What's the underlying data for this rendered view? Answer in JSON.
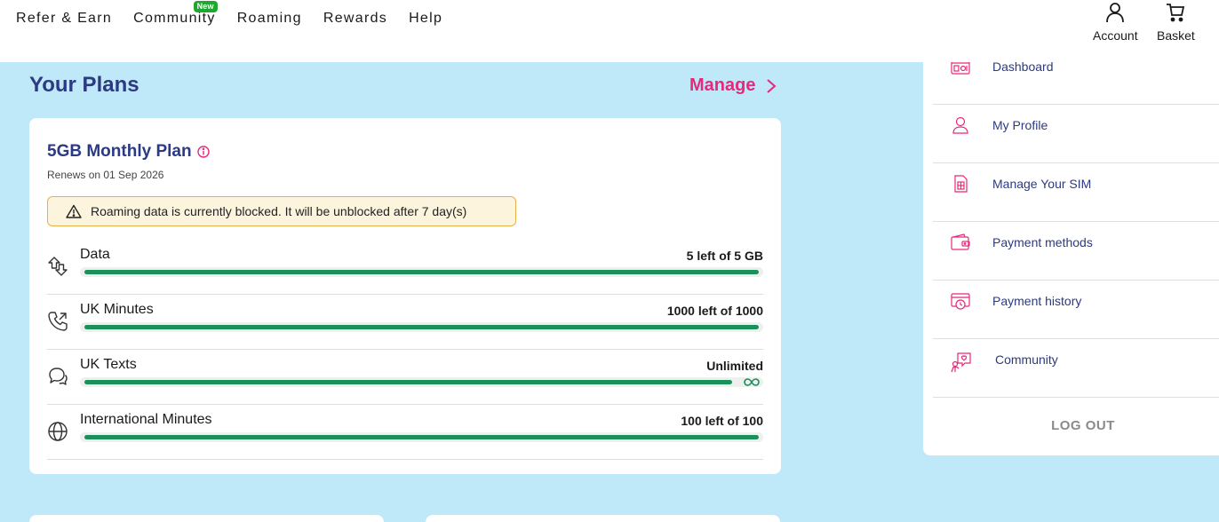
{
  "nav": {
    "items": [
      {
        "label": "Refer & Earn"
      },
      {
        "label": "Community",
        "badge": "New"
      },
      {
        "label": "Roaming"
      },
      {
        "label": "Rewards"
      },
      {
        "label": "Help"
      }
    ],
    "account_label": "Account",
    "basket_label": "Basket"
  },
  "plans": {
    "title": "Your Plans",
    "manage_label": "Manage",
    "plan_name": "5GB Monthly Plan",
    "renews": "Renews on 01 Sep 2026",
    "alert": "Roaming data is currently blocked. It will be unblocked after 7 day(s)",
    "usage": [
      {
        "name": "Data",
        "value": "5 left of 5 GB",
        "fraction": 1.0,
        "icon": "data-transfer-icon"
      },
      {
        "name": "UK Minutes",
        "value": "1000 left of 1000",
        "fraction": 1.0,
        "icon": "phone-icon"
      },
      {
        "name": "UK Texts",
        "value": "Unlimited",
        "fraction": 1.0,
        "icon": "chat-bubble-icon"
      },
      {
        "name": "International Minutes",
        "value": "100 left of 100",
        "fraction": 1.0,
        "icon": "globe-icon"
      }
    ]
  },
  "menu": {
    "items": [
      {
        "label": "Dashboard",
        "icon": "dashboard-icon"
      },
      {
        "label": "My Profile",
        "icon": "profile-icon"
      },
      {
        "label": "Manage Your SIM",
        "icon": "sim-icon"
      },
      {
        "label": "Payment methods",
        "icon": "wallet-icon"
      },
      {
        "label": "Payment history",
        "icon": "payment-history-icon"
      },
      {
        "label": "Community",
        "icon": "community-icon"
      }
    ],
    "logout_label": "LOG OUT"
  },
  "colors": {
    "page_bg": "#bfe8f8",
    "brand_navy": "#2b3a82",
    "accent_pink": "#e8287a",
    "bar_green": "#1a9158",
    "badge_green": "#1fa830"
  }
}
